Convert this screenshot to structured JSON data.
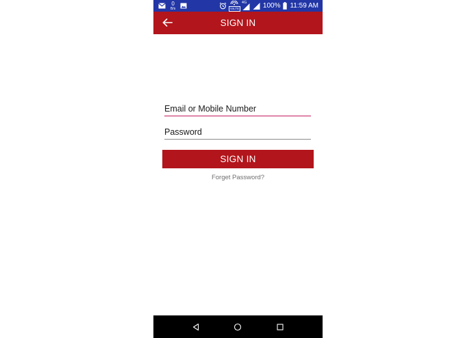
{
  "status_bar": {
    "data_label": "0",
    "data_sublabel": "B/s",
    "network_type": "4G",
    "volte_label": "VoLTE",
    "battery_percent": "100%",
    "time": "11:59 AM",
    "icons": [
      "gmail-icon",
      "data-speed-icon",
      "image-icon",
      "alarm-icon",
      "volte-hotspot-icon",
      "signal-icon",
      "signal-icon",
      "battery-icon"
    ]
  },
  "app_bar": {
    "title": "SIGN IN",
    "back_icon": "arrow-left-icon"
  },
  "form": {
    "email_placeholder": "Email or Mobile Number",
    "email_value": "",
    "password_placeholder": "Password",
    "password_value": "",
    "submit_label": "SIGN IN",
    "forget_password_label": "Forget Password?"
  },
  "nav_bar": {
    "icons": [
      "nav-back-icon",
      "nav-home-icon",
      "nav-recents-icon"
    ]
  },
  "colors": {
    "status_bar": "#2236a6",
    "primary": "#b2151b",
    "email_underline": "#c2185b",
    "nav_bar": "#000000"
  }
}
